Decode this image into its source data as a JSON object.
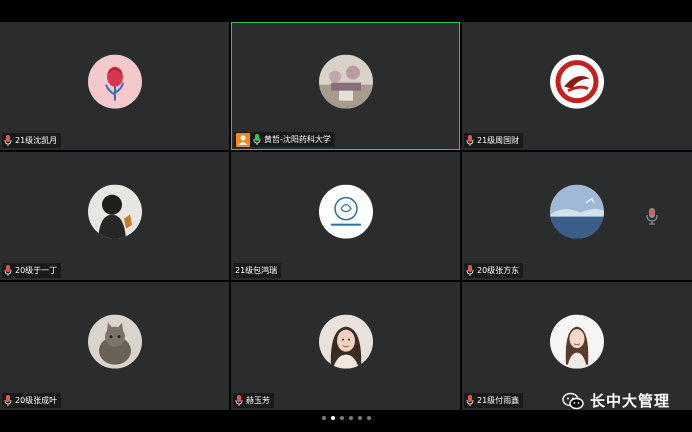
{
  "participants": [
    {
      "name": "21级沈凯月",
      "avatar": "rose-avatar-icon"
    },
    {
      "name": "黄哲-沈阳药科大学",
      "avatar": "photo-avatar-icon",
      "host": true,
      "active": true
    },
    {
      "name": "21级周国财",
      "avatar": "logo-avatar-icon"
    },
    {
      "name": "20级于一丁",
      "avatar": "silhouette-avatar-icon"
    },
    {
      "name": "21级包鸿瑞",
      "avatar": "university-seal-avatar-icon"
    },
    {
      "name": "20级张方东",
      "avatar": "seascape-avatar-icon"
    },
    {
      "name": "20级张成叶",
      "avatar": "cat-avatar-icon"
    },
    {
      "name": "赫玉芳",
      "avatar": "woman-avatar-icon"
    },
    {
      "name": "21级付雨鑫",
      "avatar": "woman2-avatar-icon"
    }
  ],
  "pagination": {
    "total": 6,
    "current": 2
  },
  "watermark": {
    "text": "长中大管理"
  },
  "colors": {
    "tile": "#2b2c2e",
    "active_border": "#35c45a",
    "host_badge": "#f08a24",
    "mic": "#e0564a"
  }
}
